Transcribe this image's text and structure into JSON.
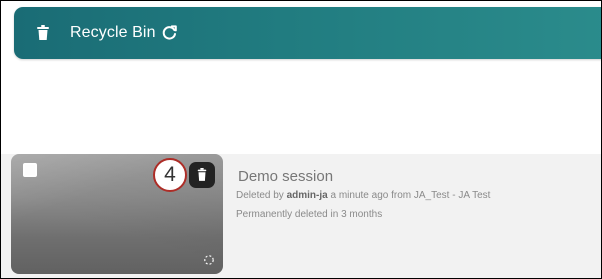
{
  "header": {
    "title": "Recycle Bin",
    "trash_icon": "trash-icon",
    "refresh_icon": "refresh-icon",
    "accent": "#217c80"
  },
  "session": {
    "title": "Demo session",
    "deleted_prefix": "Deleted by",
    "deleted_by": "admin-ja",
    "deleted_middle": "a minute ago from",
    "deleted_from": "JA_Test - JA Test",
    "permanent_text": "Permanently deleted in 3 months",
    "badge_number": "4",
    "checkbox_icon": "checkbox-icon",
    "delete_icon": "trash-icon",
    "loading_icon": "loading-spinner-icon"
  }
}
